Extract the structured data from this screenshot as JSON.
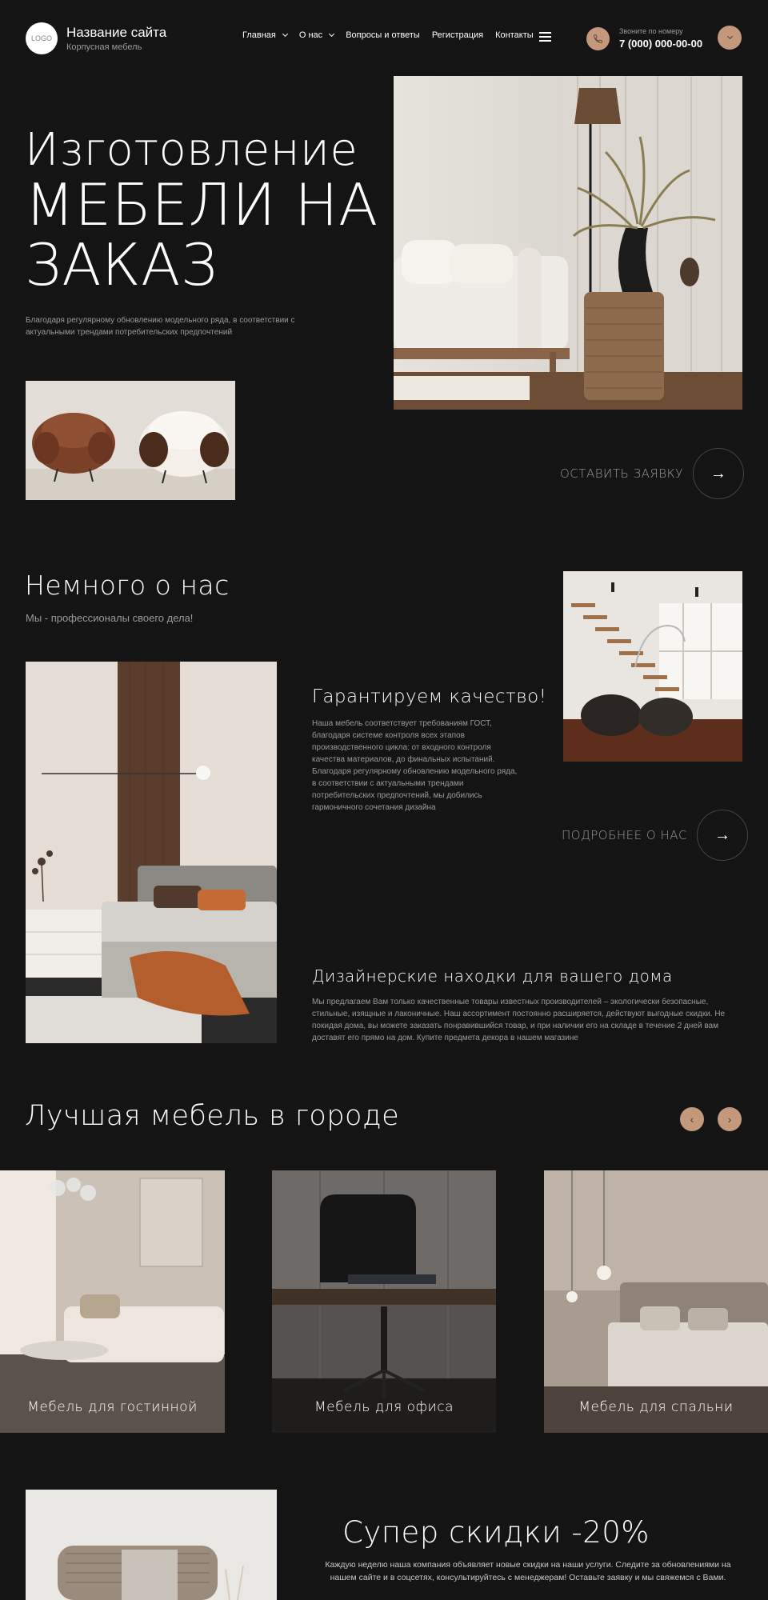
{
  "header": {
    "logo_text": "LOGO",
    "site_title": "Название сайта",
    "site_subtitle": "Корпусная мебель",
    "nav": [
      {
        "label": "Главная",
        "has_dropdown": true
      },
      {
        "label": "О нас",
        "has_dropdown": true
      },
      {
        "label": "Вопросы и ответы",
        "has_dropdown": false
      },
      {
        "label": "Регистрация",
        "has_dropdown": false
      },
      {
        "label": "Контакты",
        "has_dropdown": false
      }
    ],
    "phone_label": "Звоните по номеру",
    "phone_number": "7 (000) 000-00-00"
  },
  "hero": {
    "line1": "Изготовление",
    "line2": "МЕБЕЛИ НА",
    "line3": "ЗАКАЗ",
    "description": "Благодаря регулярному обновлению модельного ряда, в соответствии с актуальными трендами потребительских предпочтений",
    "cta_label": "ОСТАВИТЬ ЗАЯВКУ",
    "arrow": "→"
  },
  "about": {
    "title": "Немного о нас",
    "subtitle": "Мы - профессионалы своего дела!",
    "quality_title": "Гарантируем качество!",
    "quality_text": "Наша мебель соответствует требованиям ГОСТ, благодаря системе контроля всех этапов производственного цикла: от входного контроля качества материалов, до финальных испытаний. Благодаря регулярному обновлению модельного ряда, в соответствии с актуальными трендами потребительских предпочтений, мы добились гармоничного сочетания дизайна",
    "more_label": "ПОДРОБНЕЕ О НАС",
    "arrow": "→",
    "design_title": "Дизайнерские находки для вашего дома",
    "design_text": "Мы предлагаем Вам только качественные товары известных производителей – экологически безопасные, стильные, изящные и лаконичные. Наш ассортимент постоянно расширяется, действуют выгодные скидки. Не покидая дома, вы можете заказать понравившийся товар, и при наличии его на складе в течение 2 дней вам доставят его прямо на дом. Купите предмета декора в нашем магазине"
  },
  "best": {
    "title": "Лучшая мебель в городе",
    "prev": "‹",
    "next": "›",
    "cards": [
      {
        "label": "Мебель для гостинной"
      },
      {
        "label": "Мебель для офиса"
      },
      {
        "label": "Мебель для спальни"
      }
    ]
  },
  "sale": {
    "title": "Супер скидки -20%",
    "text": "Каждую неделю наша компания объявляет новые скидки на наши услуги. Следите за обновлениями на нашем сайте и в соцсетях, консультируйтесь с менеджерам! Оставьте заявку и мы свяжемся с Вами."
  },
  "colors": {
    "background": "#141414",
    "accent": "#c4987a",
    "muted_text": "#9a9a9a"
  }
}
